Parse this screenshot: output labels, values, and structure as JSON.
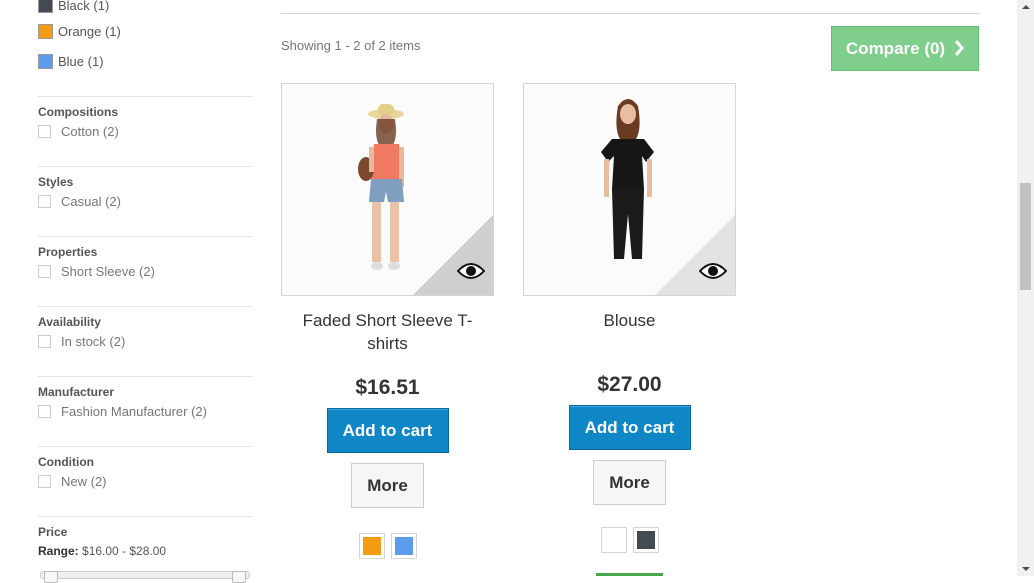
{
  "sidebar": {
    "colors": [
      {
        "label": "Black (1)",
        "color": "#434a54"
      },
      {
        "label": "Orange (1)",
        "color": "#f39c11"
      },
      {
        "label": "Blue (1)",
        "color": "#5d9cec"
      }
    ],
    "filters": [
      {
        "title": "Compositions",
        "option": "Cotton (2)"
      },
      {
        "title": "Styles",
        "option": "Casual (2)"
      },
      {
        "title": "Properties",
        "option": "Short Sleeve (2)"
      },
      {
        "title": "Availability",
        "option": "In stock (2)"
      },
      {
        "title": "Manufacturer",
        "option": "Fashion Manufacturer (2)"
      },
      {
        "title": "Condition",
        "option": "New (2)"
      }
    ],
    "price": {
      "title": "Price",
      "range_label": "Range:",
      "range_value": "$16.00 - $28.00"
    }
  },
  "main": {
    "showing": "Showing 1 - 2 of 2 items",
    "compare_label": "Compare (0)",
    "compare_color": "#7fce8b"
  },
  "products": [
    {
      "name": "Faded Short Sleeve T-shirts",
      "price": "$16.51",
      "add_label": "Add to cart",
      "more_label": "More",
      "colors": [
        "#f39c11",
        "#5d9cec"
      ]
    },
    {
      "name": "Blouse",
      "price": "$27.00",
      "add_label": "Add to cart",
      "more_label": "More",
      "colors": [
        "#ffffff",
        "#434a54"
      ]
    }
  ],
  "icons": {
    "quick_view": "eye-icon",
    "compare_arrow": "chevron-right-icon"
  }
}
